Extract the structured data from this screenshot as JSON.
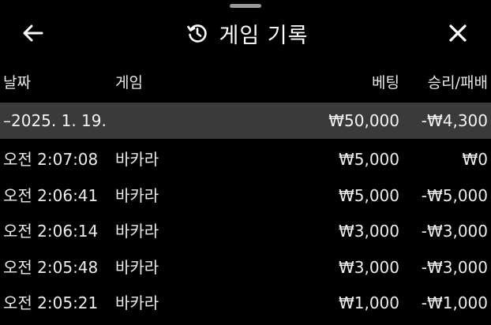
{
  "header": {
    "title": "게임 기록",
    "back_icon": "arrow-left-icon",
    "history_icon": "history-icon",
    "close_icon": "close-icon"
  },
  "columns": {
    "date": "날짜",
    "game": "게임",
    "bet": "베팅",
    "win_loss": "승리/패배"
  },
  "summary": {
    "date": "–2025. 1. 19.",
    "bet": "₩50,000",
    "win_loss": "-₩4,300"
  },
  "rows": [
    {
      "time": "오전 2:07:08",
      "game": "바카라",
      "bet": "₩5,000",
      "win_loss": "₩0"
    },
    {
      "time": "오전 2:06:41",
      "game": "바카라",
      "bet": "₩5,000",
      "win_loss": "-₩5,000"
    },
    {
      "time": "오전 2:06:14",
      "game": "바카라",
      "bet": "₩3,000",
      "win_loss": "-₩3,000"
    },
    {
      "time": "오전 2:05:48",
      "game": "바카라",
      "bet": "₩3,000",
      "win_loss": "-₩3,000"
    },
    {
      "time": "오전 2:05:21",
      "game": "바카라",
      "bet": "₩1,000",
      "win_loss": "-₩1,000"
    }
  ],
  "colors": {
    "background": "#000000",
    "summary_background": "#3a3a3a",
    "text": "#f2f2f2"
  }
}
